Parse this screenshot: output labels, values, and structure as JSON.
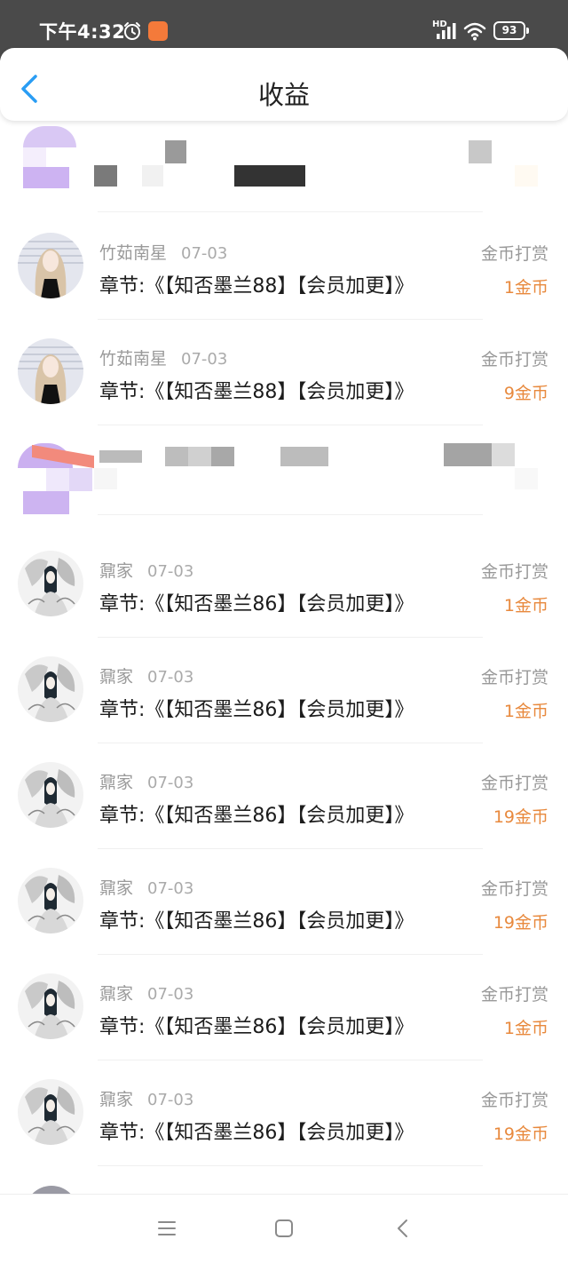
{
  "status_bar": {
    "time": "下午4:32",
    "hd": "HD",
    "battery": "93",
    "icons": [
      "alarm-icon",
      "app-badge-icon",
      "signal-icon",
      "wifi-icon",
      "battery-icon"
    ]
  },
  "header": {
    "title": "收益",
    "back_icon": "chevron-left-icon"
  },
  "colors": {
    "accent": "#2a9df4",
    "amount": "#e8893d",
    "status_bar": "#4a4a4a"
  },
  "records": [
    {
      "name": "竹茹南星",
      "date": "07-03",
      "chapter": "章节:《【知否墨兰88】【会员加更】》",
      "type": "金币打赏",
      "amount": "1金币",
      "avatar": "girl-avatar"
    },
    {
      "name": "竹茹南星",
      "date": "07-03",
      "chapter": "章节:《【知否墨兰88】【会员加更】》",
      "type": "金币打赏",
      "amount": "9金币",
      "avatar": "girl-avatar"
    },
    {
      "name": "鼐家",
      "date": "07-03",
      "chapter": "章节:《【知否墨兰86】【会员加更】》",
      "type": "金币打赏",
      "amount": "1金币",
      "avatar": "ink-avatar"
    },
    {
      "name": "鼐家",
      "date": "07-03",
      "chapter": "章节:《【知否墨兰86】【会员加更】》",
      "type": "金币打赏",
      "amount": "1金币",
      "avatar": "ink-avatar"
    },
    {
      "name": "鼐家",
      "date": "07-03",
      "chapter": "章节:《【知否墨兰86】【会员加更】》",
      "type": "金币打赏",
      "amount": "19金币",
      "avatar": "ink-avatar"
    },
    {
      "name": "鼐家",
      "date": "07-03",
      "chapter": "章节:《【知否墨兰86】【会员加更】》",
      "type": "金币打赏",
      "amount": "19金币",
      "avatar": "ink-avatar"
    },
    {
      "name": "鼐家",
      "date": "07-03",
      "chapter": "章节:《【知否墨兰86】【会员加更】》",
      "type": "金币打赏",
      "amount": "1金币",
      "avatar": "ink-avatar"
    },
    {
      "name": "鼐家",
      "date": "07-03",
      "chapter": "章节:《【知否墨兰86】【会员加更】》",
      "type": "金币打赏",
      "amount": "19金币",
      "avatar": "ink-avatar"
    }
  ],
  "nav_bar": {
    "icons": [
      "menu-icon",
      "home-square-icon",
      "back-triangle-icon"
    ]
  }
}
